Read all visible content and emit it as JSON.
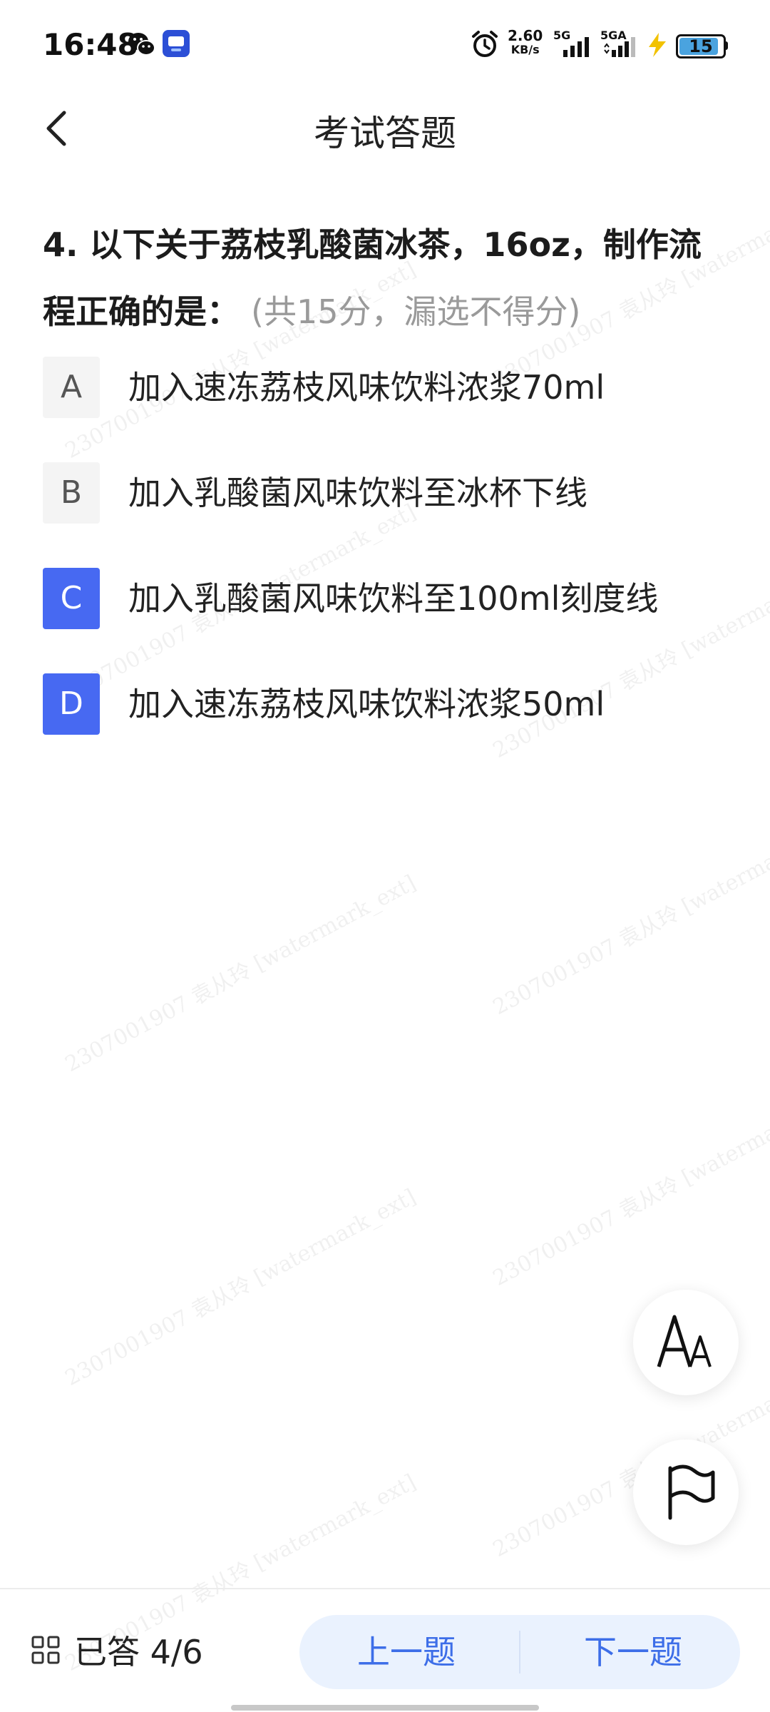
{
  "status_bar": {
    "time": "16:48",
    "speed_value": "2.60",
    "speed_unit": "KB/s",
    "net1": "5G",
    "net2": "5GA",
    "battery": "15"
  },
  "header": {
    "title": "考试答题"
  },
  "question": {
    "text": "4. 以下关于荔枝乳酸菌冰茶，16oz，制作流程正确的是：",
    "score": "(共15分，漏选不得分)"
  },
  "options": [
    {
      "letter": "A",
      "text": "加入速冻荔枝风味饮料浓浆70ml",
      "selected": false
    },
    {
      "letter": "B",
      "text": "加入乳酸菌风味饮料至冰杯下线",
      "selected": false
    },
    {
      "letter": "C",
      "text": "加入乳酸菌风味饮料至100ml刻度线",
      "selected": true
    },
    {
      "letter": "D",
      "text": "加入速冻荔枝风味饮料浓浆50ml",
      "selected": true
    }
  ],
  "fab": {
    "font_label": "A"
  },
  "bottom": {
    "answered": "已答 4/6",
    "prev": "上一题",
    "next": "下一题"
  },
  "watermark": "2307001907 袁从玲 [watermark_ext]",
  "colors": {
    "accent": "#4769f2",
    "nav_text": "#3d6ee8",
    "nav_bg": "#eaf2fe"
  }
}
